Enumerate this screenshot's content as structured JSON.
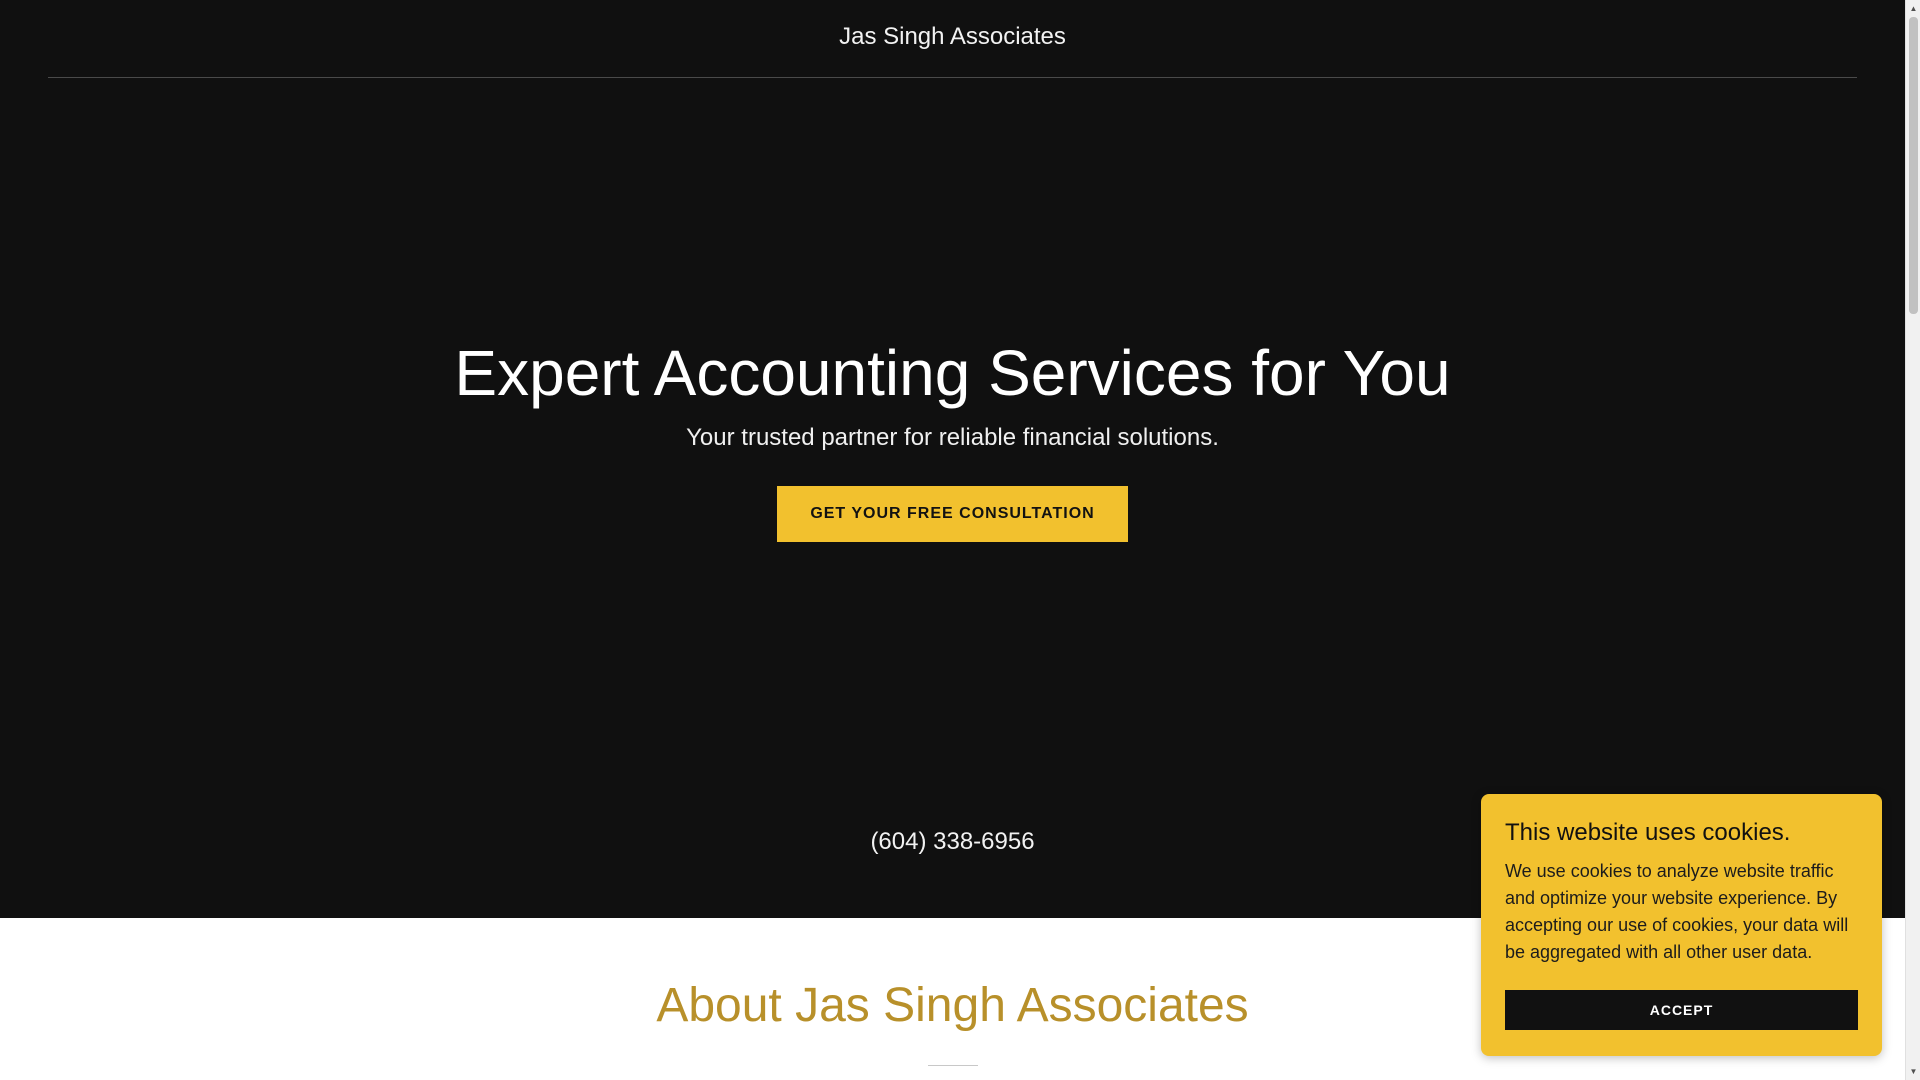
{
  "header": {
    "site_title": "Jas Singh Associates"
  },
  "hero": {
    "heading": "Expert Accounting Services for You",
    "subheading": "Your trusted partner for reliable financial solutions.",
    "cta_label": "GET YOUR FREE CONSULTATION",
    "phone": "(604) 338-6956"
  },
  "about": {
    "heading": "About Jas Singh Associates"
  },
  "cookie_banner": {
    "title": "This website uses cookies.",
    "body": "We use cookies to analyze website traffic and optimize your website experience. By accepting our use of cookies, your data will be aggregated with all other user data.",
    "accept_label": "ACCEPT"
  },
  "scrollbar": {
    "up_icon": "▲",
    "down_icon": "▼"
  },
  "colors": {
    "hero_background": "#101010",
    "accent_yellow": "#f2c12e",
    "about_heading": "#b8902a"
  }
}
